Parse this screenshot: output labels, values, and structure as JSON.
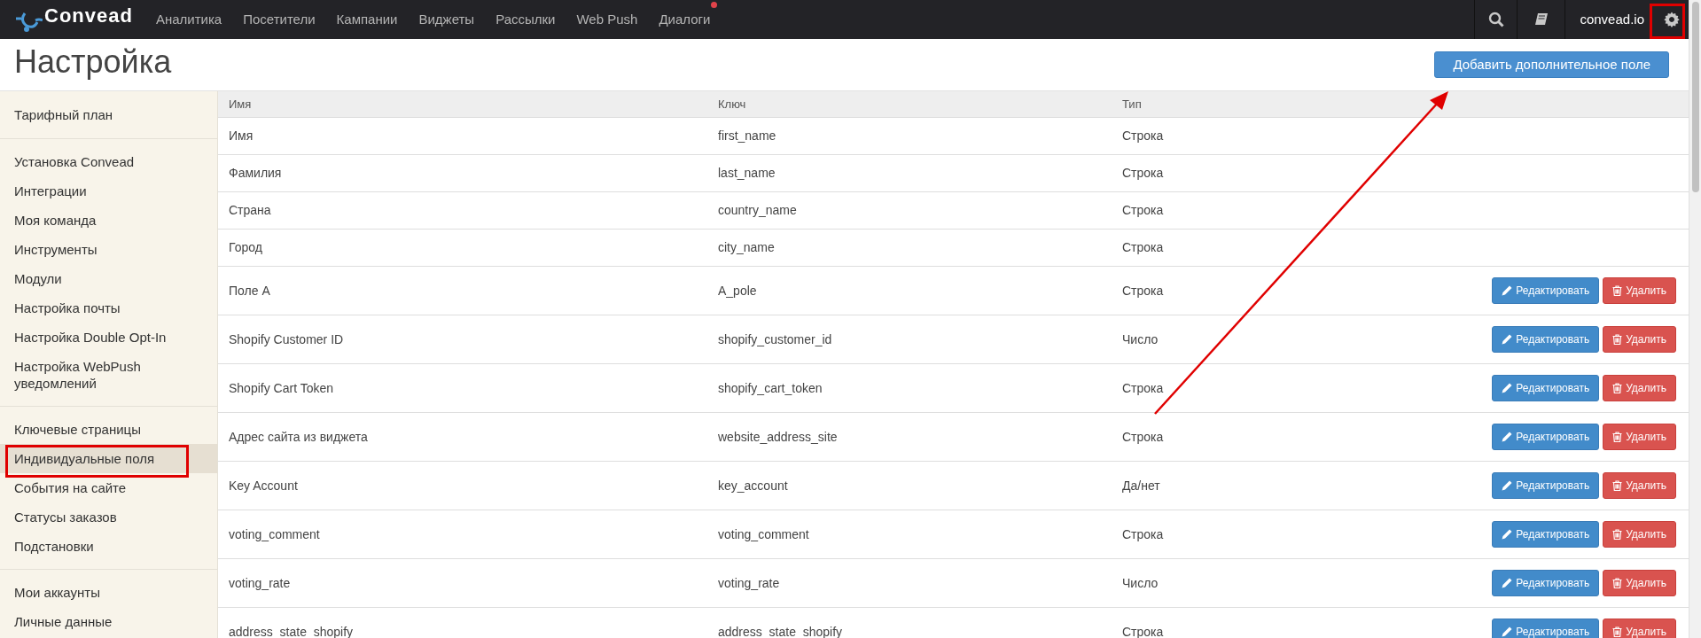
{
  "navbar": {
    "logo": "Convead",
    "items": [
      {
        "label": "Аналитика",
        "badge": false
      },
      {
        "label": "Посетители",
        "badge": false
      },
      {
        "label": "Кампании",
        "badge": false
      },
      {
        "label": "Виджеты",
        "badge": false
      },
      {
        "label": "Рассылки",
        "badge": false
      },
      {
        "label": "Web Push",
        "badge": false
      },
      {
        "label": "Диалоги",
        "badge": true
      }
    ],
    "account": "convead.io"
  },
  "page": {
    "title": "Настройка",
    "add_button": "Добавить дополнительное поле"
  },
  "sidebar": {
    "groups": [
      {
        "items": [
          {
            "label": "Тарифный план",
            "selected": false
          }
        ]
      },
      {
        "items": [
          {
            "label": "Установка Convead",
            "selected": false
          },
          {
            "label": "Интеграции",
            "selected": false
          },
          {
            "label": "Моя команда",
            "selected": false
          },
          {
            "label": "Инструменты",
            "selected": false
          },
          {
            "label": "Модули",
            "selected": false
          },
          {
            "label": "Настройка почты",
            "selected": false
          },
          {
            "label": "Настройка Double Opt-In",
            "selected": false
          },
          {
            "label": "Настройка WebPush уведомлений",
            "selected": false
          }
        ]
      },
      {
        "items": [
          {
            "label": "Ключевые страницы",
            "selected": false
          },
          {
            "label": "Индивидуальные поля",
            "selected": true
          },
          {
            "label": "События на сайте",
            "selected": false
          },
          {
            "label": "Статусы заказов",
            "selected": false
          },
          {
            "label": "Подстановки",
            "selected": false
          }
        ]
      },
      {
        "items": [
          {
            "label": "Мои аккаунты",
            "selected": false
          },
          {
            "label": "Личные данные",
            "selected": false
          }
        ]
      }
    ]
  },
  "table": {
    "columns": [
      "Имя",
      "Ключ",
      "Тип"
    ],
    "rows": [
      {
        "name": "Имя",
        "key": "first_name",
        "type": "Строка"
      },
      {
        "name": "Фамилия",
        "key": "last_name",
        "type": "Строка"
      },
      {
        "name": "Страна",
        "key": "country_name",
        "type": "Строка"
      },
      {
        "name": "Город",
        "key": "city_name",
        "type": "Строка"
      },
      {
        "name": "Поле А",
        "key": "A_pole",
        "type": "Строка",
        "buttons": [
          {
            "kind": "edit",
            "label": "Редактировать"
          },
          {
            "kind": "delete",
            "label": "Удалить"
          }
        ]
      },
      {
        "name": "Shopify Customer ID",
        "key": "shopify_customer_id",
        "type": "Число",
        "buttons": [
          {
            "kind": "edit",
            "label": "Редактировать"
          },
          {
            "kind": "delete",
            "label": "Удалить"
          }
        ]
      },
      {
        "name": "Shopify Cart Token",
        "key": "shopify_cart_token",
        "type": "Строка",
        "buttons": [
          {
            "kind": "edit",
            "label": "Редактировать"
          },
          {
            "kind": "delete",
            "label": "Удалить"
          }
        ]
      },
      {
        "name": "Адрес сайта из виджета",
        "key": "website_address_site",
        "type": "Строка",
        "buttons": [
          {
            "kind": "edit",
            "label": "Редактировать"
          },
          {
            "kind": "delete",
            "label": "Удалить"
          }
        ]
      },
      {
        "name": "Key Account",
        "key": "key_account",
        "type": "Да/нет",
        "buttons": [
          {
            "kind": "edit",
            "label": "Редактировать"
          },
          {
            "kind": "delete",
            "label": "Удалить"
          }
        ]
      },
      {
        "name": "voting_comment",
        "key": "voting_comment",
        "type": "Строка",
        "buttons": [
          {
            "kind": "edit",
            "label": "Редактировать"
          },
          {
            "kind": "delete",
            "label": "Удалить"
          }
        ]
      },
      {
        "name": "voting_rate",
        "key": "voting_rate",
        "type": "Число",
        "buttons": [
          {
            "kind": "edit",
            "label": "Редактировать"
          },
          {
            "kind": "delete",
            "label": "Удалить"
          }
        ]
      },
      {
        "name": "address_state_shopify",
        "key": "address_state_shopify",
        "type": "Строка",
        "buttons": [
          {
            "kind": "edit",
            "label": "Редактировать"
          },
          {
            "kind": "delete",
            "label": "Удалить"
          }
        ]
      }
    ]
  }
}
